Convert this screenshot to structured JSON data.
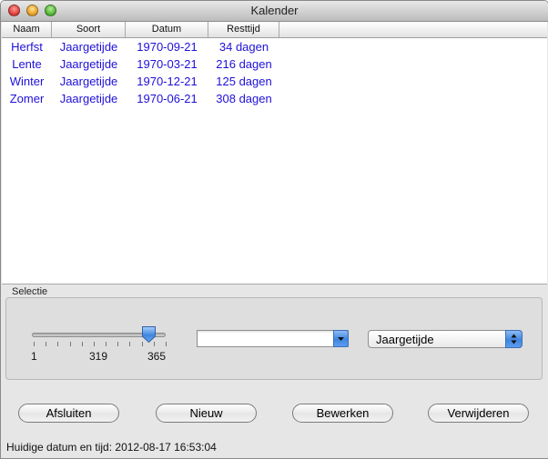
{
  "window": {
    "title": "Kalender"
  },
  "table": {
    "columns": [
      "Naam",
      "Soort",
      "Datum",
      "Resttijd"
    ],
    "rows": [
      [
        "Herfst",
        "Jaargetijde",
        "1970-09-21",
        "34 dagen"
      ],
      [
        "Lente",
        "Jaargetijde",
        "1970-03-21",
        "216 dagen"
      ],
      [
        "Winter",
        "Jaargetijde",
        "1970-12-21",
        "125 dagen"
      ],
      [
        "Zomer",
        "Jaargetijde",
        "1970-06-21",
        "308 dagen"
      ]
    ],
    "text_color": "#1f10d8"
  },
  "selection": {
    "label": "Selectie",
    "slider": {
      "min_label": "1",
      "value_label": "319",
      "max_label": "365",
      "min": 1,
      "max": 365,
      "value": 319
    },
    "combo": {
      "value": ""
    },
    "type_popup": {
      "value": "Jaargetijde"
    }
  },
  "buttons": {
    "quit": "Afsluiten",
    "new": "Nieuw",
    "edit": "Bewerken",
    "delete": "Verwijderen"
  },
  "status": {
    "text": "Huidige datum en tijd: 2012-08-17 16:53:04"
  },
  "colors": {
    "accent_blue": "#3f86e0"
  }
}
